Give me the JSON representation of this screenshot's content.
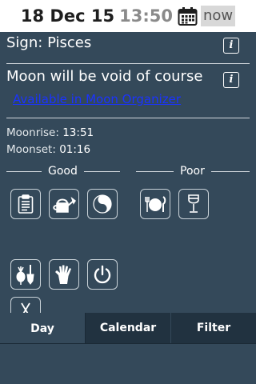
{
  "header": {
    "date": "18 Dec 15",
    "time": "13:50",
    "now_label": "now",
    "calendar_icon": "calendar-icon"
  },
  "sign": {
    "label": "Sign:",
    "value": "Pisces"
  },
  "moon_void": {
    "text": "Moon will be void of course",
    "link": "Available in Moon Organizer"
  },
  "moon_times": {
    "moonrise_label": "Moonrise:",
    "moonrise": "13:51",
    "moonset_label": "Moonset:",
    "moonset": "01:16"
  },
  "sections": {
    "good": "Good",
    "poor": "Poor"
  },
  "good_icons": [
    "clipboard-icon",
    "watering-can-icon",
    "yin-yang-icon",
    "radish-shovel-icon",
    "hand-icon",
    "power-icon",
    "scissors-icon"
  ],
  "poor_icons": [
    "plate-cutlery-icon",
    "wine-glass-icon"
  ],
  "tabs": [
    {
      "label": "Day",
      "active": true
    },
    {
      "label": "Calendar",
      "active": false
    },
    {
      "label": "Filter",
      "active": false
    }
  ],
  "colors": {
    "background": "#34495a",
    "link": "#1a33ff",
    "tab_inactive": "#213240"
  }
}
